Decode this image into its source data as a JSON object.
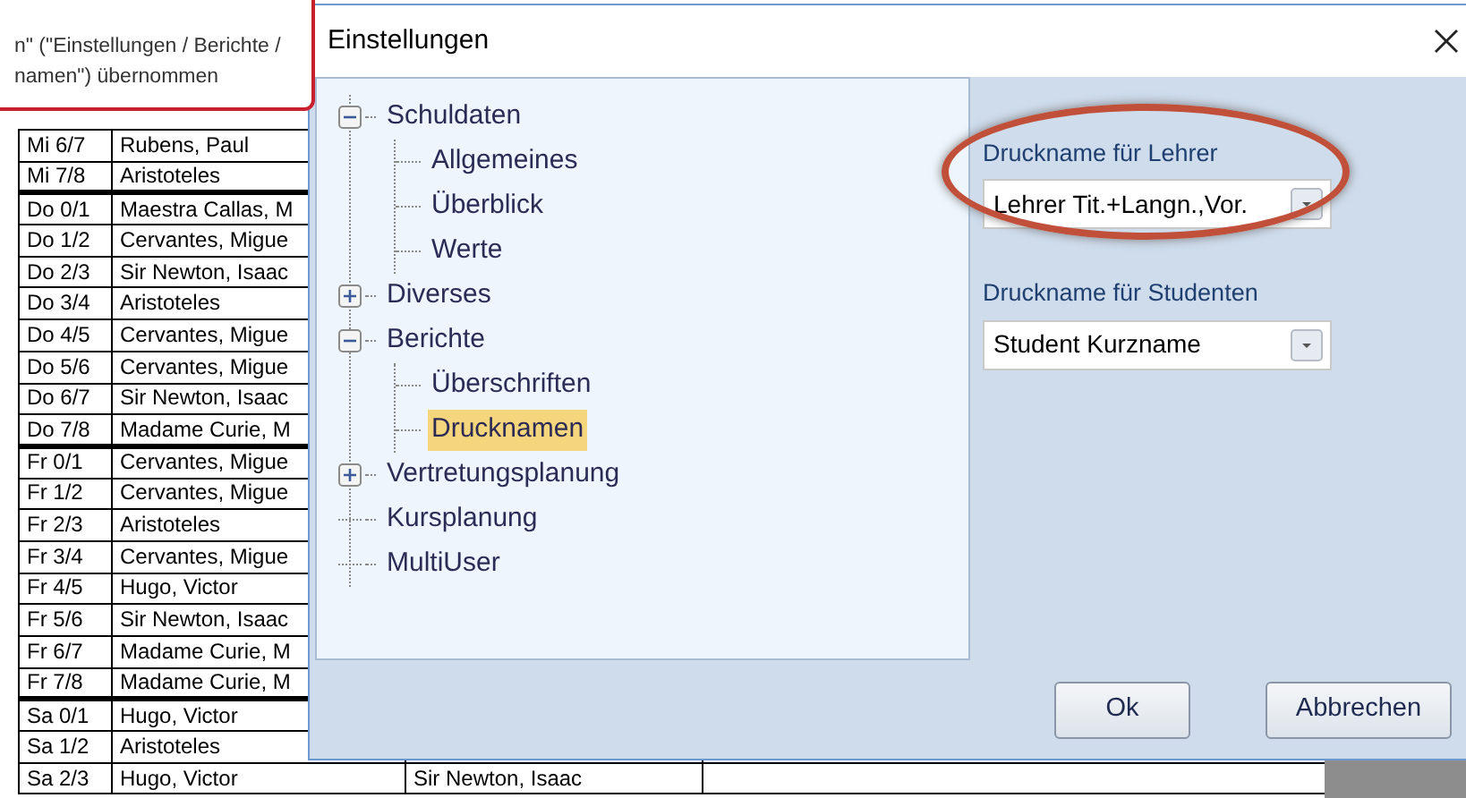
{
  "background_table": {
    "rows": [
      {
        "cells": [
          "Mi 6/7",
          "Rubens, Paul"
        ],
        "group_start": false
      },
      {
        "cells": [
          "Mi 7/8",
          "Aristoteles"
        ],
        "group_start": false
      },
      {
        "cells": [
          "Do 0/1",
          "Maestra Callas, M"
        ],
        "group_start": true
      },
      {
        "cells": [
          "Do 1/2",
          "Cervantes, Migue"
        ],
        "group_start": false
      },
      {
        "cells": [
          "Do 2/3",
          "Sir Newton, Isaac"
        ],
        "group_start": false
      },
      {
        "cells": [
          "Do 3/4",
          "Aristoteles"
        ],
        "group_start": false
      },
      {
        "cells": [
          "Do 4/5",
          "Cervantes, Migue"
        ],
        "group_start": false
      },
      {
        "cells": [
          "Do 5/6",
          "Cervantes, Migue"
        ],
        "group_start": false
      },
      {
        "cells": [
          "Do 6/7",
          "Sir Newton, Isaac"
        ],
        "group_start": false
      },
      {
        "cells": [
          "Do 7/8",
          "Madame Curie, M"
        ],
        "group_start": false
      },
      {
        "cells": [
          "Fr 0/1",
          "Cervantes, Migue"
        ],
        "group_start": true
      },
      {
        "cells": [
          "Fr 1/2",
          "Cervantes, Migue"
        ],
        "group_start": false
      },
      {
        "cells": [
          "Fr 2/3",
          "Aristoteles"
        ],
        "group_start": false
      },
      {
        "cells": [
          "Fr 3/4",
          "Cervantes, Migue"
        ],
        "group_start": false
      },
      {
        "cells": [
          "Fr 4/5",
          "Hugo, Victor"
        ],
        "group_start": false
      },
      {
        "cells": [
          "Fr 5/6",
          "Sir Newton, Isaac"
        ],
        "group_start": false
      },
      {
        "cells": [
          "Fr 6/7",
          "Madame Curie, M"
        ],
        "group_start": false
      },
      {
        "cells": [
          "Fr 7/8",
          "Madame Curie, M"
        ],
        "group_start": false
      },
      {
        "cells": [
          "Sa 0/1",
          "Hugo, Victor"
        ],
        "group_start": true
      },
      {
        "cells": [
          "Sa 1/2",
          "Aristoteles"
        ],
        "group_start": false
      },
      {
        "cells": [
          "Sa 2/3",
          "Hugo, Victor",
          "Sir Newton, Isaac"
        ],
        "group_start": false
      }
    ]
  },
  "callout": {
    "lines": [
      "n\" (\"Einstellungen / Berichte /",
      "namen\") übernommen"
    ]
  },
  "dialog": {
    "title": "Einstellungen",
    "tree": [
      {
        "label": "Schuldaten",
        "expanded": true,
        "selected": false,
        "children": [
          {
            "label": "Allgemeines",
            "selected": false
          },
          {
            "label": "Überblick",
            "selected": false
          },
          {
            "label": "Werte",
            "selected": false
          }
        ]
      },
      {
        "label": "Diverses",
        "expanded": false,
        "selected": false
      },
      {
        "label": "Berichte",
        "expanded": true,
        "selected": false,
        "children": [
          {
            "label": "Überschriften",
            "selected": false
          },
          {
            "label": "Drucknamen",
            "selected": true
          }
        ]
      },
      {
        "label": "Vertretungsplanung",
        "expanded": false,
        "selected": false
      },
      {
        "label": "Kursplanung",
        "selected": false
      },
      {
        "label": "MultiUser",
        "selected": false
      }
    ],
    "fields": [
      {
        "label": "Druckname für Lehrer",
        "value": "Lehrer Tit.+Langn.,Vor.",
        "highlighted": true
      },
      {
        "label": "Druckname für Studenten",
        "value": "Student Kurzname",
        "highlighted": false
      }
    ],
    "buttons": [
      "Ok",
      "Abbrechen"
    ]
  }
}
